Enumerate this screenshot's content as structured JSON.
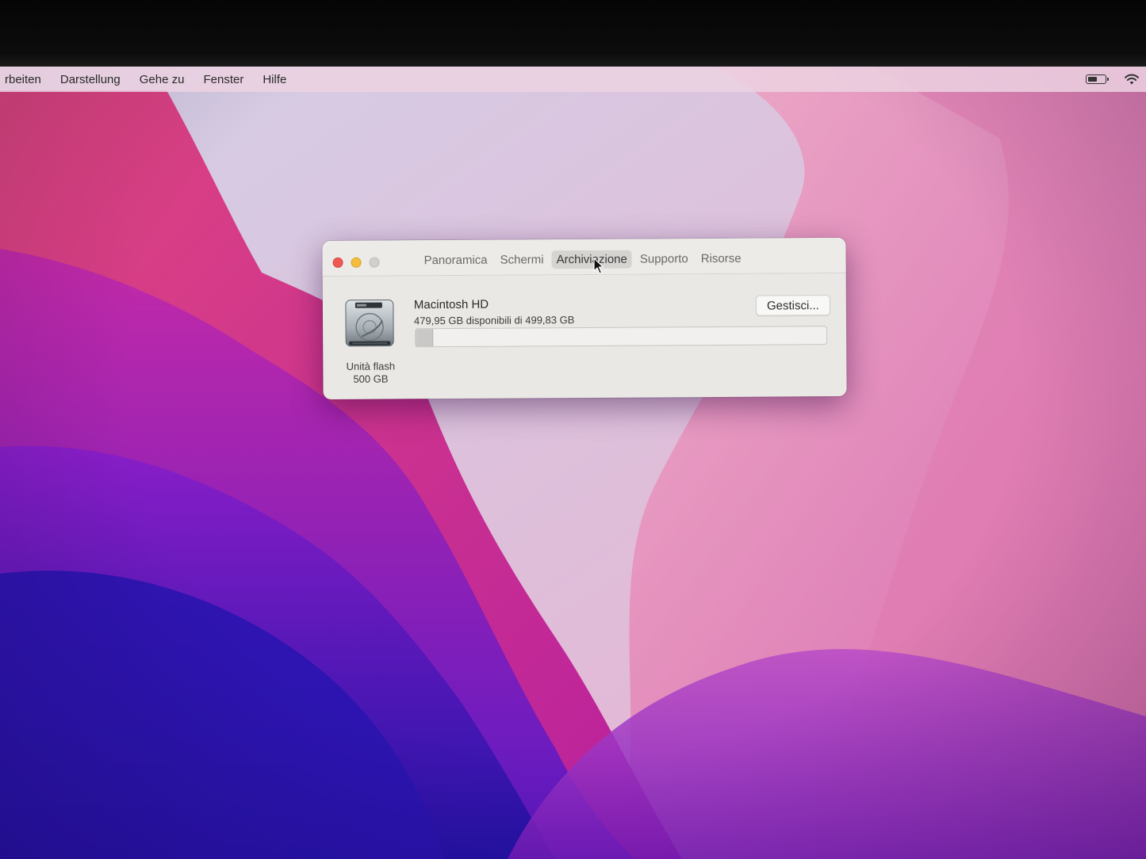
{
  "menubar": {
    "items": [
      "rbeiten",
      "Darstellung",
      "Gehe zu",
      "Fenster",
      "Hilfe"
    ]
  },
  "status": {
    "battery_icon": "battery-half-icon",
    "wifi_icon": "wifi-icon"
  },
  "window": {
    "tabs": [
      "Panoramica",
      "Schermi",
      "Archiviazione",
      "Supporto",
      "Risorse"
    ],
    "active_tab": "Archiviazione",
    "disk": {
      "name": "Macintosh HD",
      "availability": "479,95 GB disponibili di 499,83 GB",
      "type_label": "Unità flash",
      "size_label": "500 GB",
      "used_fraction": 0.04,
      "icon": "hard-drive-icon"
    },
    "manage_button": "Gestisci..."
  },
  "colors": {
    "close": "#ee5a52",
    "minimize": "#f4bd3c",
    "zoom_disabled": "#d1d0ce"
  }
}
